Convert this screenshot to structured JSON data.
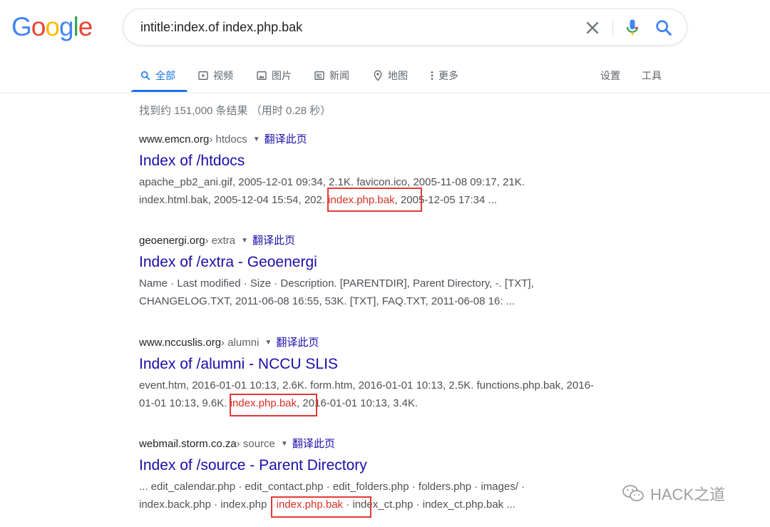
{
  "logo": {
    "letters": [
      "G",
      "o",
      "o",
      "g",
      "l",
      "e"
    ],
    "colors": [
      "#4285f4",
      "#ea4335",
      "#fbbc05",
      "#4285f4",
      "#34a853",
      "#ea4335"
    ]
  },
  "search": {
    "query": "intitle:index.of index.php.bak"
  },
  "tabs": [
    {
      "label": "全部",
      "icon": "search-icon"
    },
    {
      "label": "视频",
      "icon": "play-icon"
    },
    {
      "label": "图片",
      "icon": "image-icon"
    },
    {
      "label": "新闻",
      "icon": "news-icon"
    },
    {
      "label": "地图",
      "icon": "map-pin-icon"
    },
    {
      "label": "更多",
      "icon": "more-dots-icon"
    },
    {
      "label": "设置"
    },
    {
      "label": "工具"
    }
  ],
  "stats": "找到约 151,000 条结果 （用时 0.28 秒）",
  "translate_label": "翻译此页",
  "results": [
    {
      "domain": "www.emcn.org",
      "crumb": " › htdocs",
      "title": "Index of /htdocs",
      "lines": [
        [
          "apache_pb2_ani.gif, 2005-12-01 09:34, 2.1K. favicon.ico, 2005-11-08 09:17, 21K."
        ],
        [
          "index.html.bak, 2005-12-04 15:54, 202. ",
          "index.php.bak",
          ", 2005-12-05 17:34 ..."
        ]
      ]
    },
    {
      "domain": "geoenergi.org",
      "crumb": " › extra",
      "title": "Index of /extra - Geoenergi",
      "lines": [
        [
          "Name · Last modified · Size · Description. [PARENTDIR], Parent Directory, -. [TXT],"
        ],
        [
          "CHANGELOG.TXT, 2011-06-08 16:55, 53K. [TXT], FAQ.TXT, 2011-06-08 16: ..."
        ]
      ]
    },
    {
      "domain": "www.nccuslis.org",
      "crumb": " › alumni",
      "title": "Index of /alumni - NCCU SLIS",
      "lines": [
        [
          "event.htm, 2016-01-01 10:13, 2.6K. form.htm, 2016-01-01 10:13, 2.5K. functions.php.bak, 2016-"
        ],
        [
          "01-01 10:13, 9.6K. ",
          "index.php.bak",
          ", 2016-01-01 10:13, 3.4K."
        ]
      ]
    },
    {
      "domain": "webmail.storm.co.za",
      "crumb": " › source",
      "title": "Index of /source - Parent Directory",
      "lines": [
        [
          "... edit_calendar.php · edit_contact.php · edit_folders.php · folders.php · images/ ·"
        ],
        [
          "index.back.php · index.php · ",
          "index.php.bak",
          " · index_ct.php · index_ct.php.bak ..."
        ]
      ]
    }
  ],
  "watermark": "HACK之道"
}
